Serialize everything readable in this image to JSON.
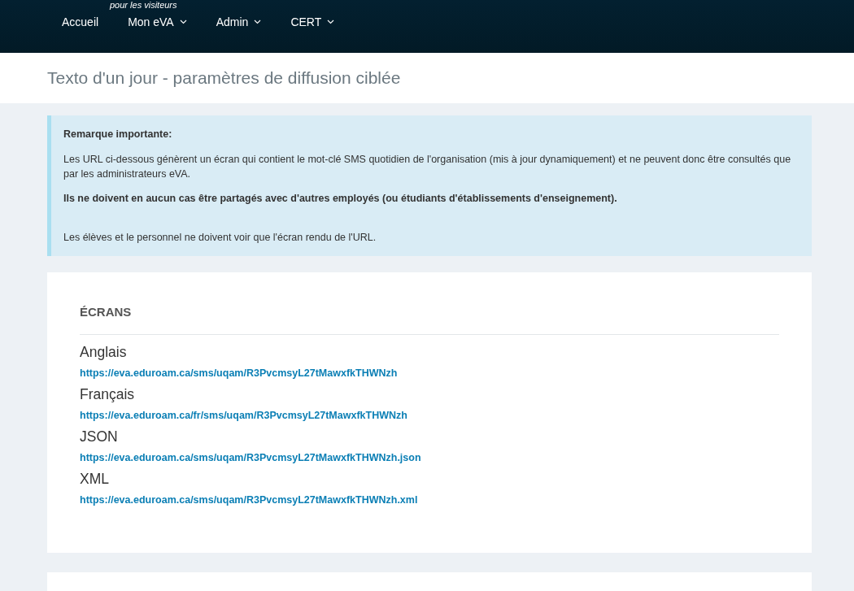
{
  "header": {
    "tagline": "pour les visiteurs"
  },
  "nav": [
    {
      "label": "Accueil",
      "has_menu": false
    },
    {
      "label": "Mon eVA",
      "has_menu": true
    },
    {
      "label": "Admin",
      "has_menu": true
    },
    {
      "label": "CERT",
      "has_menu": true
    }
  ],
  "page_title": "Texto d'un jour - paramètres de diffusion ciblée",
  "notice": {
    "heading": "Remarque importante:",
    "paragraphs": [
      {
        "text": "Les URL ci-dessous génèrent un écran qui contient le mot-clé SMS quotidien de l'organisation (mis à jour dynamiquement) et ne peuvent donc être consultés que par les administrateurs eVA.",
        "bold": false
      },
      {
        "text": "Ils ne doivent en aucun cas être partagés avec d'autres employés (ou étudiants d'établissements d'enseignement).",
        "bold": true
      },
      {
        "text": "Les élèves et le personnel ne doivent voir que l'écran rendu de l'URL.",
        "bold": false
      }
    ]
  },
  "screens": {
    "heading": "ÉCRANS",
    "items": [
      {
        "label": "Anglais",
        "url": "https://eva.eduroam.ca/sms/uqam/R3PvcmsyL27tMawxfkTHWNzh"
      },
      {
        "label": "Français",
        "url": "https://eva.eduroam.ca/fr/sms/uqam/R3PvcmsyL27tMawxfkTHWNzh"
      },
      {
        "label": "JSON",
        "url": "https://eva.eduroam.ca/sms/uqam/R3PvcmsyL27tMawxfkTHWNzh.json"
      },
      {
        "label": "XML",
        "url": "https://eva.eduroam.ca/sms/uqam/R3PvcmsyL27tMawxfkTHWNzh.xml"
      }
    ]
  }
}
